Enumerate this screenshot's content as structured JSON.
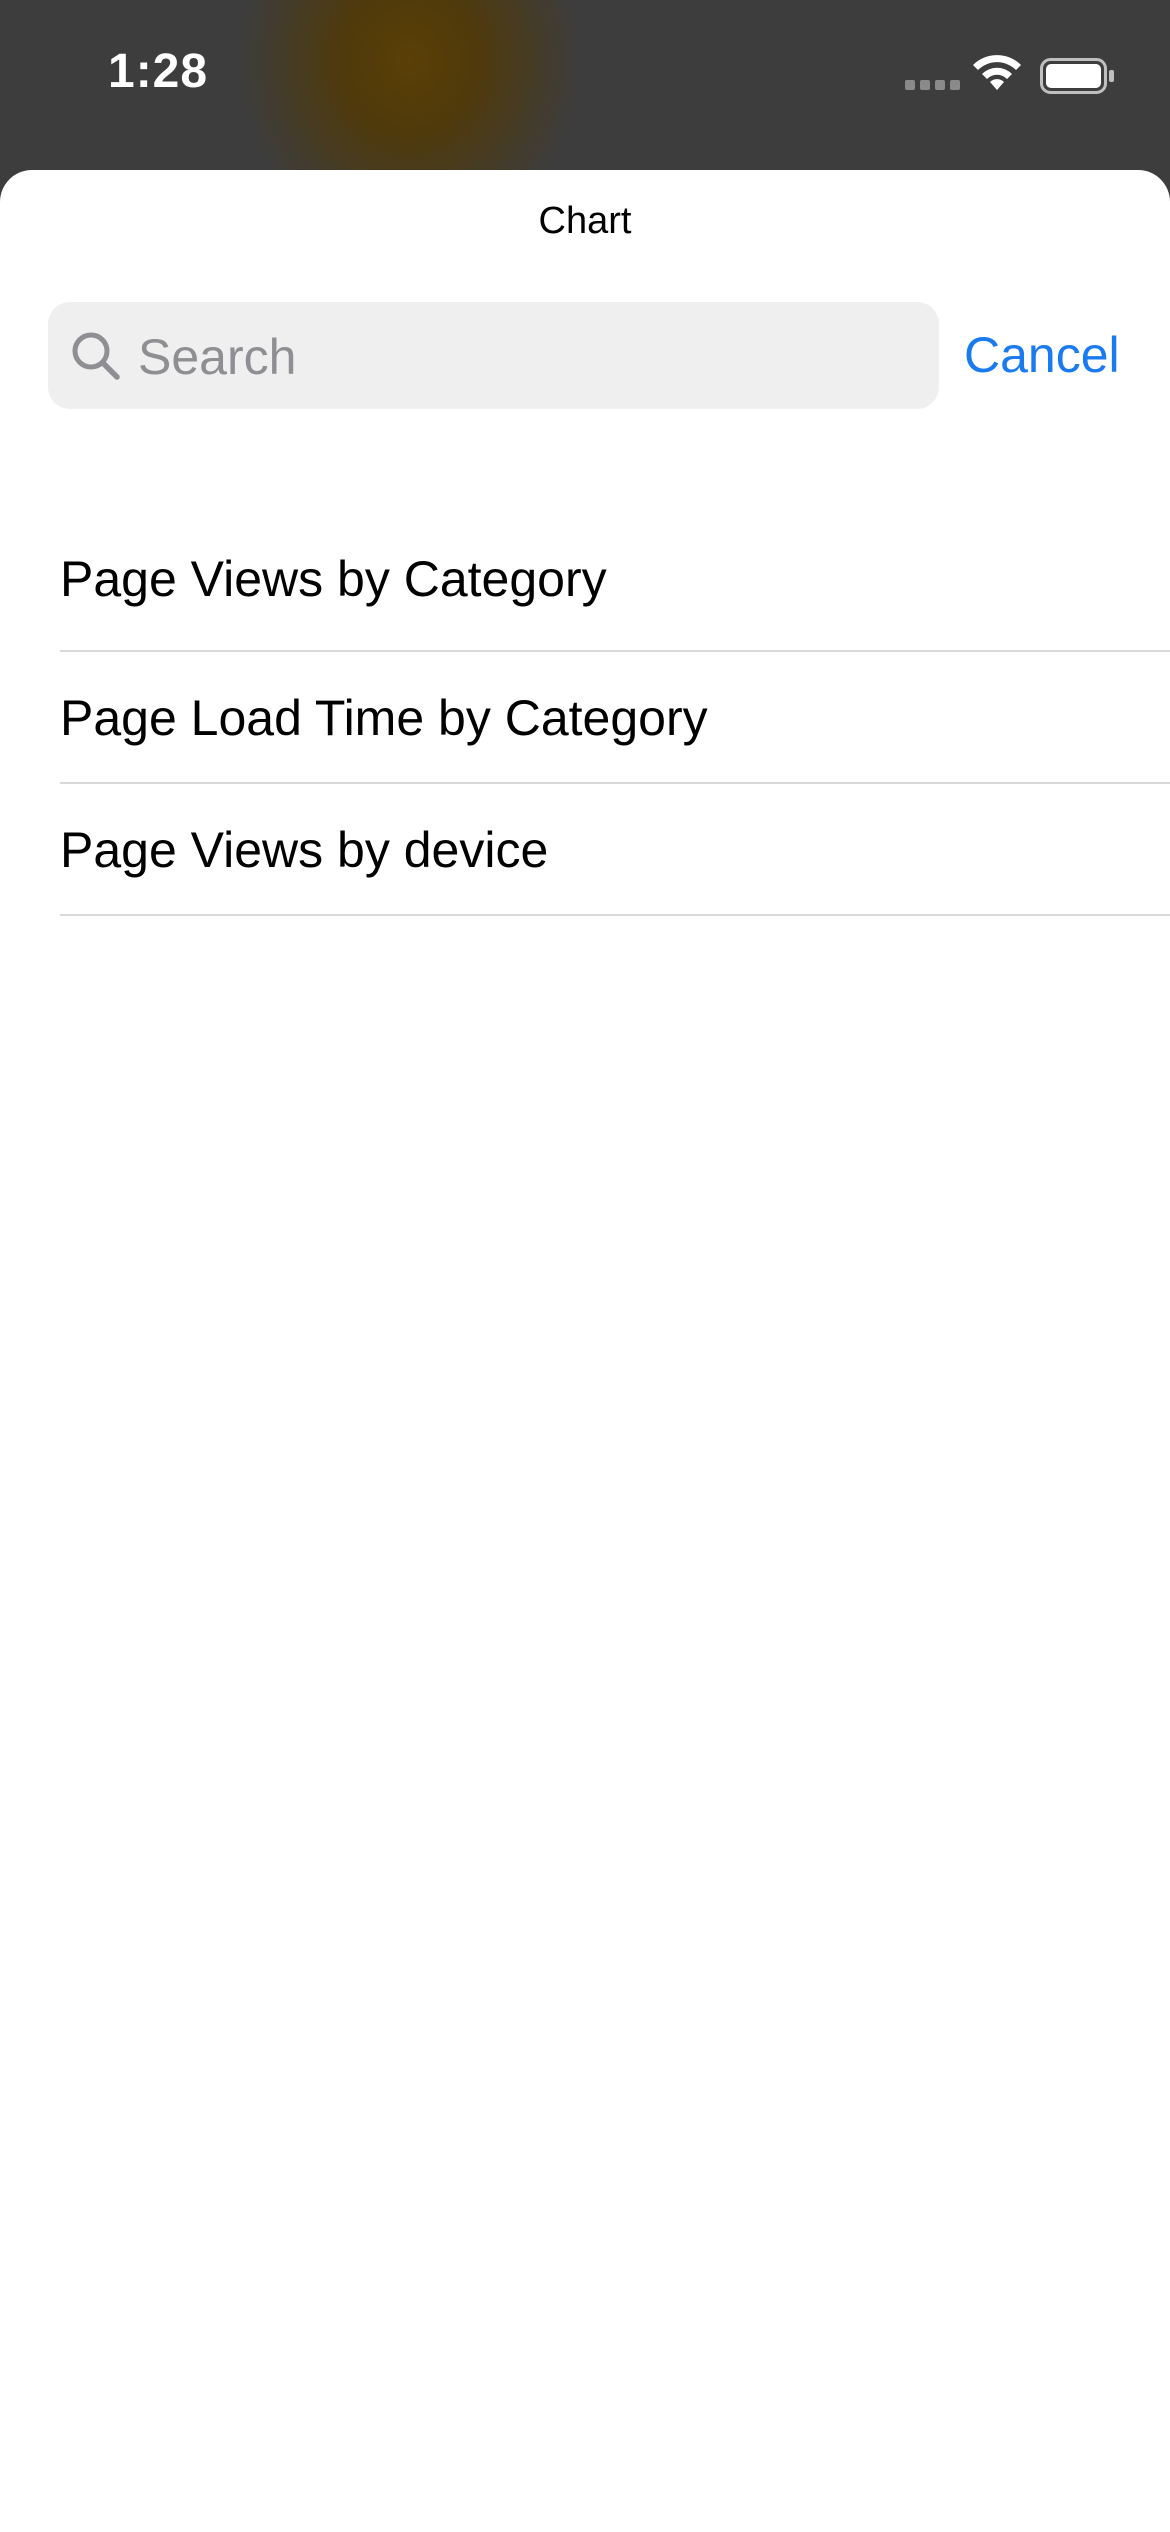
{
  "status_bar": {
    "time": "1:28",
    "signal_icon": "cellular-signal-icon",
    "wifi_icon": "wifi-icon",
    "battery_icon": "battery-icon"
  },
  "sheet": {
    "title": "Chart",
    "search": {
      "placeholder": "Search",
      "icon": "search-icon"
    },
    "cancel_label": "Cancel",
    "items": [
      {
        "label": "Page Views by Category"
      },
      {
        "label": "Page Load Time by Category"
      },
      {
        "label": "Page Views by device"
      }
    ]
  },
  "colors": {
    "accent": "#1a7bef",
    "sheet_background": "#ffffff",
    "search_background": "#efefef",
    "separator": "#d8d8d8",
    "backdrop": "#3d3d3d",
    "backdrop_glow": "#5a3f06"
  }
}
